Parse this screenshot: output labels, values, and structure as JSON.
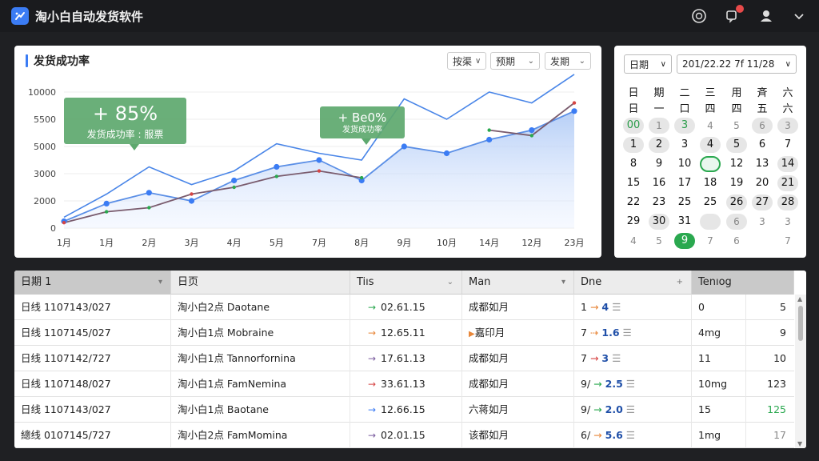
{
  "app": {
    "title": "淘小白自动发货软件"
  },
  "titlebar_icons": [
    "help-icon",
    "notification-icon",
    "user-icon",
    "chevron-down-icon"
  ],
  "chart_panel": {
    "title": "发货成功率",
    "filters": [
      "按渠",
      "预期",
      "发期"
    ]
  },
  "chart_data": {
    "type": "line",
    "categories": [
      "1月",
      "1月",
      "2月",
      "3月",
      "4月",
      "5月",
      "7月",
      "8月",
      "9月",
      "10月",
      "14月",
      "12月",
      "23月"
    ],
    "yticks": [
      "10000",
      "5500",
      "5000",
      "3000",
      "2000",
      "0"
    ],
    "series": [
      {
        "color": "#4a86e8",
        "values": [
          0.08,
          0.25,
          0.45,
          0.32,
          0.42,
          0.62,
          0.55,
          0.5,
          0.95,
          0.8,
          1.0,
          0.92,
          1.13
        ]
      },
      {
        "color": "#5b8fe6",
        "values": [
          0.05,
          0.18,
          0.26,
          0.2,
          0.35,
          0.45,
          0.5,
          0.35,
          0.6,
          0.55,
          0.65,
          0.72,
          0.86
        ]
      },
      {
        "color": "#7a5c6e",
        "values": [
          0.04,
          0.12,
          0.15,
          0.25,
          0.3,
          0.38,
          0.42,
          0.37,
          null,
          null,
          0.72,
          0.68,
          0.92
        ]
      }
    ],
    "annotations": [
      {
        "value": "+ 85%",
        "label": "发货成功率 : 服票"
      },
      {
        "value": "+ Be0%",
        "label": "发货成功率"
      }
    ]
  },
  "calendar": {
    "select_unit": "日期",
    "select_range": "201/22.22 7f 11/28",
    "headers": [
      [
        "日",
        "日"
      ],
      [
        "期",
        "一"
      ],
      [
        "二",
        "口"
      ],
      [
        "三",
        "四"
      ],
      [
        "用",
        "四"
      ],
      [
        "斉",
        "五"
      ],
      [
        "六",
        "六"
      ]
    ],
    "rows": [
      [
        [
          "00",
          "green shade"
        ],
        [
          "1",
          "dim shade"
        ],
        [
          "3",
          "green shade"
        ],
        [
          "4",
          "dim"
        ],
        [
          "5",
          "dim"
        ],
        [
          "6",
          "dim shade"
        ],
        [
          "3",
          "dim shade"
        ]
      ],
      [
        [
          "1",
          "shade"
        ],
        [
          "2",
          "shade"
        ],
        [
          "3",
          ""
        ],
        [
          "4",
          "shade"
        ],
        [
          "5",
          "shade"
        ],
        [
          "6",
          ""
        ],
        [
          "7",
          ""
        ]
      ],
      [
        [
          "8",
          ""
        ],
        [
          "9",
          ""
        ],
        [
          "10",
          ""
        ],
        [
          "",
          "ring"
        ],
        [
          "12",
          ""
        ],
        [
          "13",
          ""
        ],
        [
          "14",
          "shade"
        ]
      ],
      [
        [
          "15",
          ""
        ],
        [
          "16",
          ""
        ],
        [
          "17",
          ""
        ],
        [
          "18",
          ""
        ],
        [
          "19",
          ""
        ],
        [
          "20",
          ""
        ],
        [
          "21",
          "shade"
        ]
      ],
      [
        [
          "22",
          ""
        ],
        [
          "23",
          ""
        ],
        [
          "25",
          ""
        ],
        [
          "25",
          ""
        ],
        [
          "26",
          "shade"
        ],
        [
          "27",
          "shade"
        ],
        [
          "28",
          "shade"
        ]
      ],
      [
        [
          "29",
          ""
        ],
        [
          "30",
          "shade"
        ],
        [
          "31",
          ""
        ],
        [
          "",
          "shade"
        ],
        [
          "6",
          "dim shade"
        ],
        [
          "3",
          "dim"
        ],
        [
          "3",
          "dim"
        ]
      ],
      [
        [
          "4",
          "dim"
        ],
        [
          "5",
          "dim"
        ],
        [
          "9",
          "fill"
        ],
        [
          "7",
          "dim"
        ],
        [
          "6",
          "dim"
        ],
        [
          "",
          ""
        ],
        [
          "7",
          "dim"
        ]
      ]
    ]
  },
  "table": {
    "headers": [
      "日期 1",
      "日页",
      "Tiıs",
      "Man",
      "Dne",
      "Tenıog"
    ],
    "rows": [
      {
        "c1": "日线 1107143/027",
        "c2": "淘小白2点 Daotane",
        "arrow": "→",
        "arrow_color": "#2aa84f",
        "c3": "02.61.15",
        "c4": "成都如月",
        "c4_mark": "",
        "c5a": "1",
        "c5_arrow": "→",
        "c5_color": "#e8873a",
        "c5b": "4",
        "c6": "0",
        "c7": "5",
        "c7_color": "#222"
      },
      {
        "c1": "日线 1107145/027",
        "c2": "淘小白1点 Mobraine",
        "arrow": "→",
        "arrow_color": "#e8873a",
        "c3": "12.65.11",
        "c4": "嘉印月",
        "c4_mark": "▶",
        "c5a": "7",
        "c5_arrow": "⇢",
        "c5_color": "#e8873a",
        "c5b": "1.6",
        "c6": "4mg",
        "c7": "9",
        "c7_color": "#222"
      },
      {
        "c1": "日线 1107142/727",
        "c2": "淘小白1点 Tannorfornina",
        "arrow": "→",
        "arrow_color": "#7a5c9e",
        "c3": "17.61.13",
        "c4": "成都如月",
        "c4_mark": "",
        "c5a": "7",
        "c5_arrow": "→",
        "c5_color": "#d64545",
        "c5b": "3",
        "c6": "11",
        "c7": "10",
        "c7_color": "#222"
      },
      {
        "c1": "日线 1107148/027",
        "c2": "淘小白1点 FamNemina",
        "arrow": "→",
        "arrow_color": "#d64545",
        "c3": "33.61.13",
        "c4": "成都如月",
        "c4_mark": "",
        "c5a": "9/",
        "c5_arrow": "→",
        "c5_color": "#2aa84f",
        "c5b": "2.5",
        "c6": "10mg",
        "c7": "123",
        "c7_color": "#222"
      },
      {
        "c1": "日线 1107143/027",
        "c2": "淘小白1点 Baotane",
        "arrow": "→",
        "arrow_color": "#3b7cf4",
        "c3": "12.66.15",
        "c4": "六蒋如月",
        "c4_mark": "",
        "c5a": "9/",
        "c5_arrow": "→",
        "c5_color": "#2aa84f",
        "c5b": "2.0",
        "c6": "15",
        "c7": "125",
        "c7_color": "#2aa84f"
      },
      {
        "c1": "總线 0107145/727",
        "c2": "淘小白2点 FamMomina",
        "arrow": "→",
        "arrow_color": "#7a5c9e",
        "c3": "02.01.15",
        "c4": "该都如月",
        "c4_mark": "",
        "c5a": "6/",
        "c5_arrow": "→",
        "c5_color": "#e8873a",
        "c5b": "5.6",
        "c6": "1mg",
        "c7": "17",
        "c7_color": "#888"
      }
    ]
  }
}
